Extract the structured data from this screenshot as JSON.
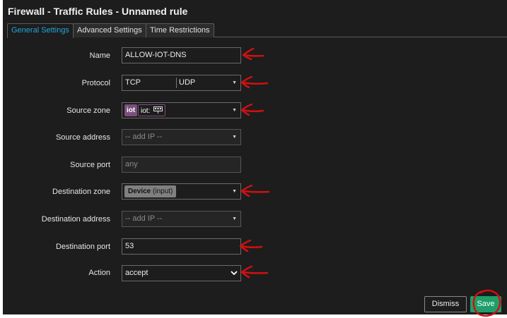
{
  "window": {
    "title": "Firewall - Traffic Rules - Unnamed rule"
  },
  "tabs": [
    {
      "label": "General Settings",
      "active": true
    },
    {
      "label": "Advanced Settings",
      "active": false
    },
    {
      "label": "Time Restrictions",
      "active": false
    }
  ],
  "form": {
    "name": {
      "label": "Name",
      "value": "ALLOW-IOT-DNS"
    },
    "protocol": {
      "label": "Protocol",
      "values": [
        "TCP",
        "UDP"
      ]
    },
    "source_zone": {
      "label": "Source zone",
      "chip": "iot",
      "chip2": "iot:",
      "network_icon": "network-icon"
    },
    "source_address": {
      "label": "Source address",
      "placeholder": "-- add IP --"
    },
    "source_port": {
      "label": "Source port",
      "placeholder": "any"
    },
    "destination_zone": {
      "label": "Destination zone",
      "chip": "Device",
      "chip_suffix": "(input)"
    },
    "destination_address": {
      "label": "Destination address",
      "placeholder": "-- add IP --"
    },
    "destination_port": {
      "label": "Destination port",
      "value": "53"
    },
    "action": {
      "label": "Action",
      "value": "accept"
    }
  },
  "buttons": {
    "dismiss": "Dismiss",
    "save": "Save"
  },
  "colors": {
    "accent": "#22a6d8",
    "save": "#1e9e6a",
    "zone_iot": "#7b4f7b",
    "annotation": "#d01010"
  }
}
